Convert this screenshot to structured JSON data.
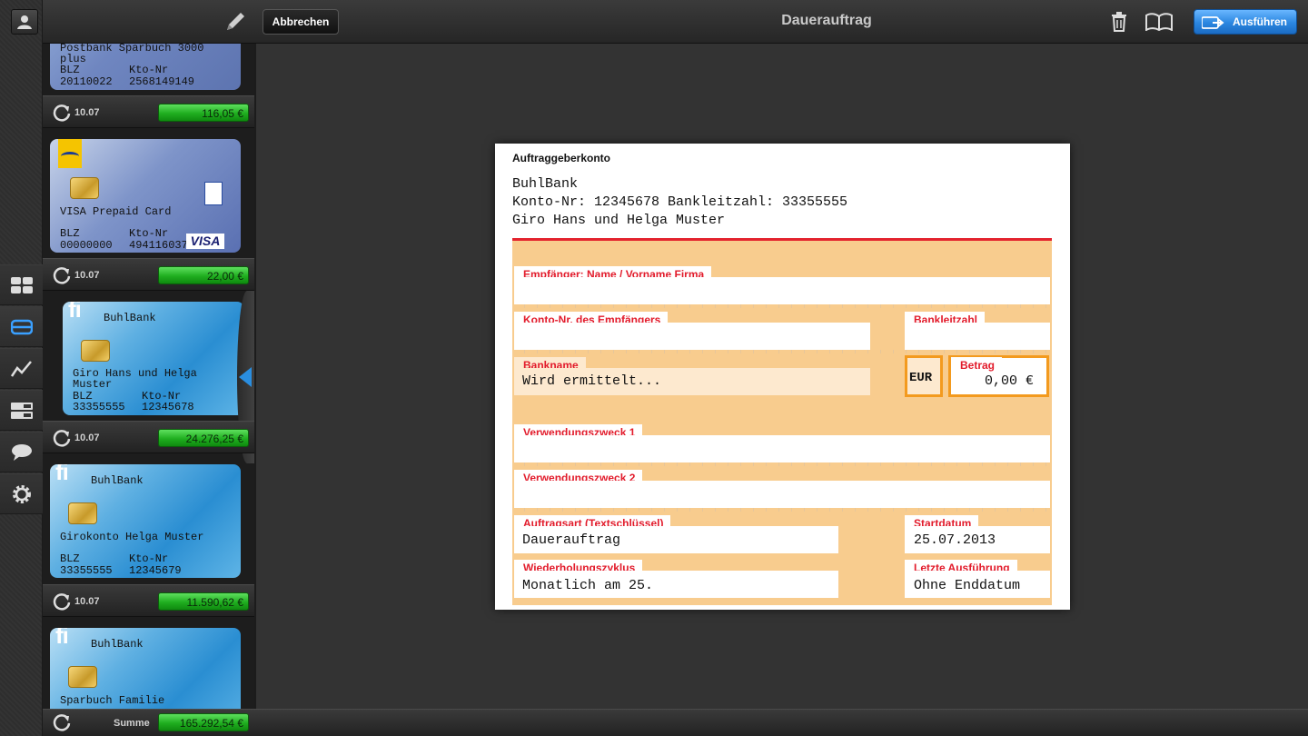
{
  "header": {
    "cancel_label": "Abbrechen",
    "title": "Dauerauftrag",
    "run_label": "Ausführen"
  },
  "rail": {
    "items": [
      "user-icon",
      "dashboard-icon",
      "cards-icon",
      "chart-icon",
      "list-icon",
      "chat-icon",
      "gear-icon"
    ]
  },
  "accounts": [
    {
      "name": "Postbank Sparbuch 3000\nplus",
      "blz_label": "BLZ",
      "kto_label": "Kto-Nr",
      "blz": "20110022",
      "kto": "2568149149",
      "date": "10.07",
      "amount": "116,05 €"
    },
    {
      "name": "VISA Prepaid Card",
      "blz_label": "BLZ",
      "kto_label": "Kto-Nr",
      "blz": "00000000",
      "kto": "494116037",
      "date": "10.07",
      "amount": "22,00 €"
    },
    {
      "bank": "BuhlBank",
      "name": "Giro Hans und Helga\nMuster",
      "blz_label": "BLZ",
      "kto_label": "Kto-Nr",
      "blz": "33355555",
      "kto": "12345678",
      "date": "10.07",
      "amount": "24.276,25 €"
    },
    {
      "bank": "BuhlBank",
      "name": "Girokonto Helga Muster",
      "blz_label": "BLZ",
      "kto_label": "Kto-Nr",
      "blz": "33355555",
      "kto": "12345679",
      "date": "10.07",
      "amount": "11.590,62 €"
    },
    {
      "bank": "BuhlBank",
      "name": "Sparbuch Familie"
    }
  ],
  "summary": {
    "label": "Summe",
    "amount": "165.292,54 €"
  },
  "form": {
    "section_title": "Auftraggeberkonto",
    "sender_bank": "BuhlBank",
    "sender_account_line": "Konto-Nr: 12345678 Bankleitzahl: 33355555",
    "sender_name": "Giro Hans und Helga Muster",
    "recipient_label": "Empfänger: Name / Vorname Firma",
    "recipient_value": "",
    "recipient_account_label": "Konto-Nr. des Empfängers",
    "recipient_account_value": "",
    "bank_code_label": "Bankleitzahl",
    "bank_code_value": "",
    "bank_name_label": "Bankname",
    "bank_name_value": "Wird ermittelt...",
    "currency": "EUR",
    "amount_label": "Betrag",
    "amount_value": "0,00 €",
    "purpose1_label": "Verwendungszweck 1",
    "purpose1_value": "",
    "purpose2_label": "Verwendungszweck 2",
    "purpose2_value": "",
    "order_type_label": "Auftragsart (Textschlüssel)",
    "order_type_value": "Dauerauftrag",
    "start_date_label": "Startdatum",
    "start_date_value": "25.07.2013",
    "cycle_label": "Wiederholungszyklus",
    "cycle_value": "Monatlich am 25.",
    "last_exec_label": "Letzte Ausführung",
    "last_exec_value": "Ohne Enddatum"
  },
  "colors": {
    "form_accent": "#e21b2b",
    "form_background": "#f8cc8e",
    "amount_green": "#1fae1f",
    "primary_button": "#2b86e0"
  }
}
